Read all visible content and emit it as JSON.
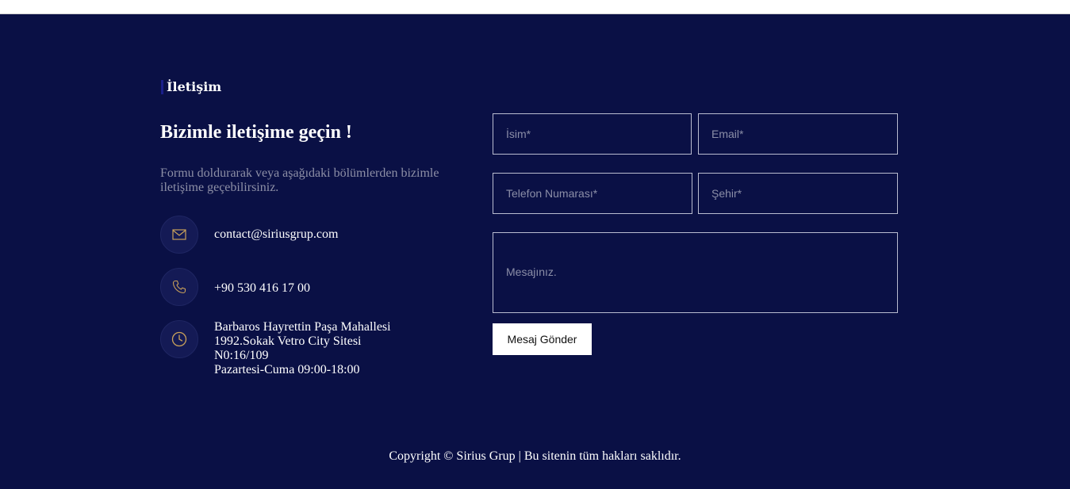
{
  "section": {
    "label": "İletişim",
    "heading": "Bizimle iletişime geçin !",
    "intro": "Formu doldurarak veya aşağıdaki bölümlerden bizimle iletişime geçebilirsiniz."
  },
  "contact_info": {
    "email": {
      "icon": "mail-icon",
      "text": "contact@siriusgrup.com"
    },
    "phone": {
      "icon": "phone-icon",
      "text": "+90 530 416 17 00"
    },
    "address": {
      "icon": "clock-icon",
      "lines": [
        "Barbaros Hayrettin Paşa Mahallesi",
        "1992.Sokak Vetro City Sitesi",
        "N0:16/109",
        "Pazartesi-Cuma 09:00-18:00"
      ]
    }
  },
  "form": {
    "name_placeholder": "İsim*",
    "email_placeholder": "Email*",
    "phone_placeholder": "Telefon Numarası*",
    "city_placeholder": "Şehir*",
    "message_placeholder": "Mesajınız.",
    "submit_label": "Mesaj Gönder"
  },
  "footer": {
    "copyright": "Copyright © Sirius Grup | Bu sitenin tüm hakları saklıdır."
  },
  "colors": {
    "background": "#0a1045",
    "accent_icon": "#c9a15a",
    "text": "#ffffff",
    "muted_text": "#8d8fa6",
    "button_bg": "#ffffff"
  }
}
